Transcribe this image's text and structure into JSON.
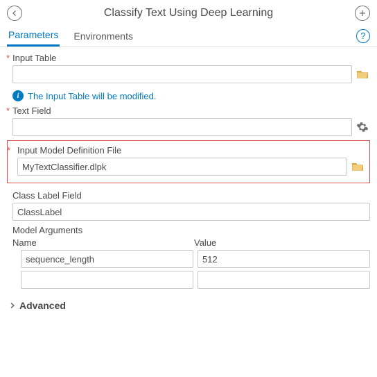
{
  "title": "Classify Text Using Deep Learning",
  "tabs": {
    "parameters": "Parameters",
    "environments": "Environments"
  },
  "fields": {
    "input_table": {
      "label": "Input Table",
      "value": ""
    },
    "input_table_info": "The Input Table will be modified.",
    "text_field": {
      "label": "Text Field",
      "value": ""
    },
    "model_file": {
      "label": "Input Model Definition File",
      "value": "MyTextClassifier.dlpk"
    },
    "class_label": {
      "label": "Class Label Field",
      "value": "ClassLabel"
    },
    "model_args": {
      "label": "Model Arguments",
      "name_hdr": "Name",
      "value_hdr": "Value",
      "rows": [
        {
          "name": "sequence_length",
          "value": "512"
        },
        {
          "name": "",
          "value": ""
        }
      ]
    }
  },
  "advanced": "Advanced"
}
